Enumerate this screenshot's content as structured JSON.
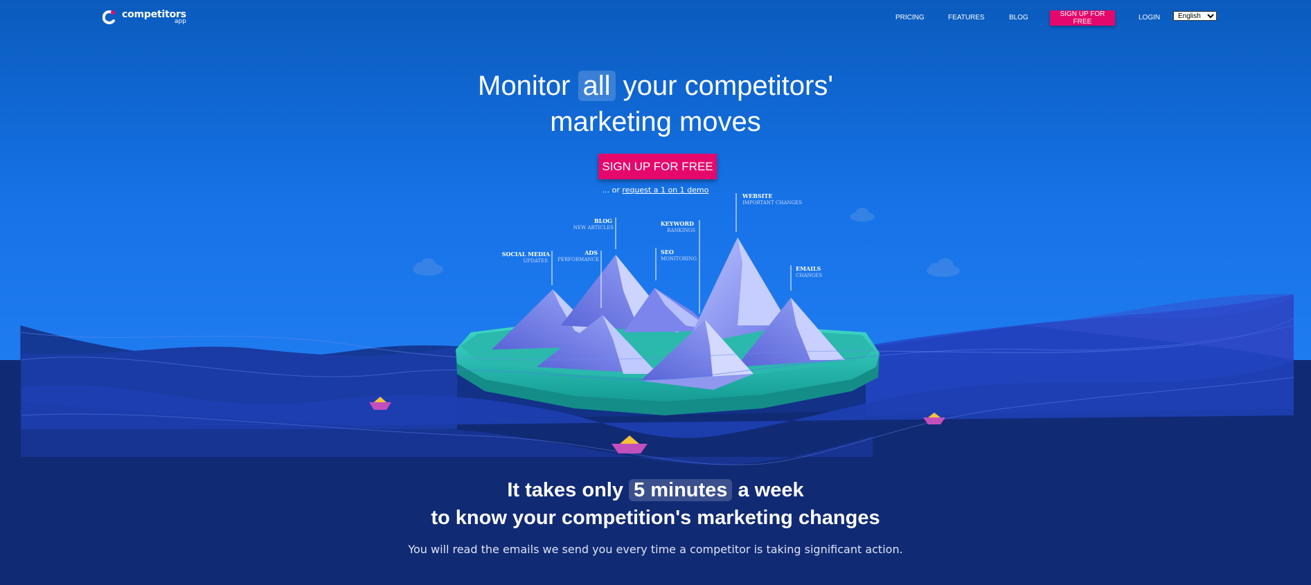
{
  "nav": {
    "logo_name": "competitors",
    "logo_sub": "app",
    "links": [
      "PRICING",
      "FEATURES",
      "BLOG"
    ],
    "cta": "SIGN UP FOR FREE",
    "login": "LOGIN",
    "language": "English"
  },
  "hero": {
    "title_before": "Monitor",
    "title_highlight": "all",
    "title_after": "your competitors'",
    "title_line2": "marketing moves",
    "cta": "SIGN UP FOR FREE",
    "demo_prefix": "... or",
    "demo_link": "request a 1 on 1 demo"
  },
  "illustration": {
    "labels": [
      {
        "title": "SOCIAL MEDIA",
        "sub": "UPDATES"
      },
      {
        "title": "ADS",
        "sub": "PERFORMANCE"
      },
      {
        "title": "BLOG",
        "sub": "NEW ARTICLES"
      },
      {
        "title": "SEO",
        "sub": "MONITORING"
      },
      {
        "title": "KEYWORD",
        "sub": "RANKINGS"
      },
      {
        "title": "WEBSITE",
        "sub": "IMPORTANT CHANGES"
      },
      {
        "title": "EMAILS",
        "sub": "CHANGES"
      }
    ]
  },
  "section2": {
    "line1_before": "It takes only",
    "line1_highlight": "5 minutes",
    "line1_after": "a week",
    "line2": "to know your competition's marketing changes",
    "description": "You will read the emails we send you every time a competitor is taking significant action."
  },
  "colors": {
    "accent": "#e5086c",
    "hero_top": "#0a5bbd",
    "hero_bottom": "#1f7cf0",
    "navy": "#112a74",
    "island_teal": "#1fc3b4"
  }
}
